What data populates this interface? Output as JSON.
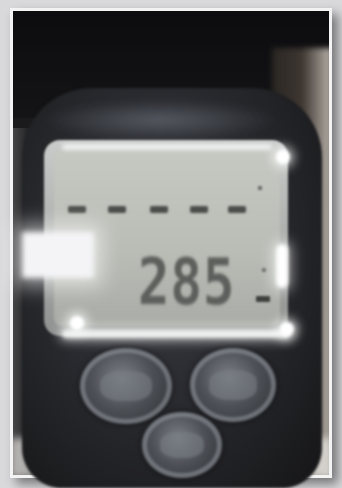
{
  "photo": {
    "subject": "handheld-meter",
    "display": {
      "reading": "285",
      "segment_count": 5
    },
    "buttons": [
      {
        "icon": "button-left-icon"
      },
      {
        "icon": "button-right-icon"
      },
      {
        "icon": "button-bottom-icon"
      }
    ],
    "colors": {
      "lcd": "#bfc2bb",
      "digits": "#5c5f5b",
      "body": "#26272b"
    }
  }
}
